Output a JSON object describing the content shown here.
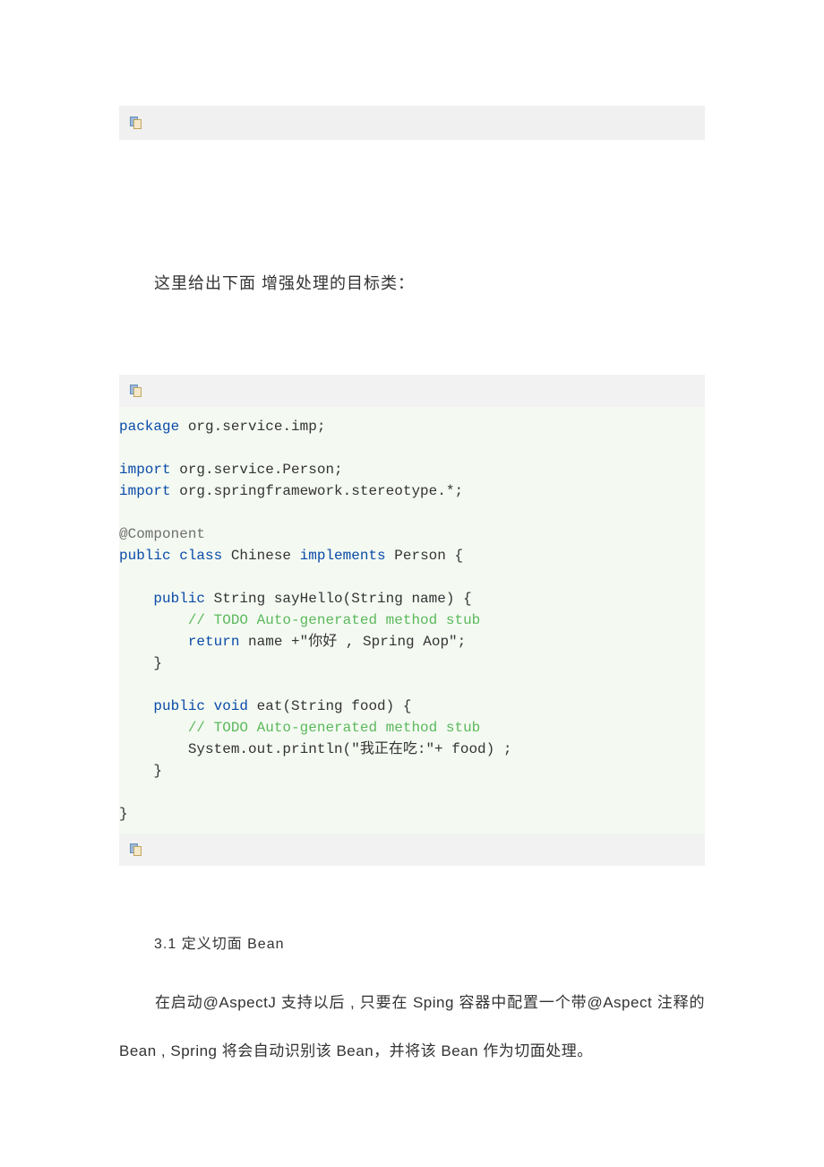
{
  "intro_paragraph": "这里给出下面 增强处理的目标类：",
  "code": {
    "line1a": "package",
    "line1b": " org.service.imp;",
    "line3a": "import",
    "line3b": " org.service.Person;",
    "line4a": "import",
    "line4b": " org.springframework.stereotype.*;",
    "line6": "@Component",
    "line7a": "public",
    "line7b": " class",
    "line7c": " Chinese ",
    "line7d": "implements",
    "line7e": " Person {",
    "line9a": "    public",
    "line9b": " String sayHello(String name) {",
    "line10": "        // TODO Auto-generated method stub",
    "line11a": "        return",
    "line11b": " name +\"你好 , Spring Aop\";",
    "line12": "    }",
    "line14a": "    public",
    "line14b": " void",
    "line14c": " eat(String food) {",
    "line15": "        // TODO Auto-generated method stub",
    "line16": "        System.out.println(\"我正在吃:\"+ food) ;",
    "line17": "    }",
    "line19": "}"
  },
  "section_heading": "3.1  定义切面 Bean",
  "body_paragraph": "在启动@AspectJ 支持以后 , 只要在 Sping  容器中配置一个带@Aspect 注释的 Bean   , Spring 将会自动识别该 Bean，并将该 Bean 作为切面处理。"
}
